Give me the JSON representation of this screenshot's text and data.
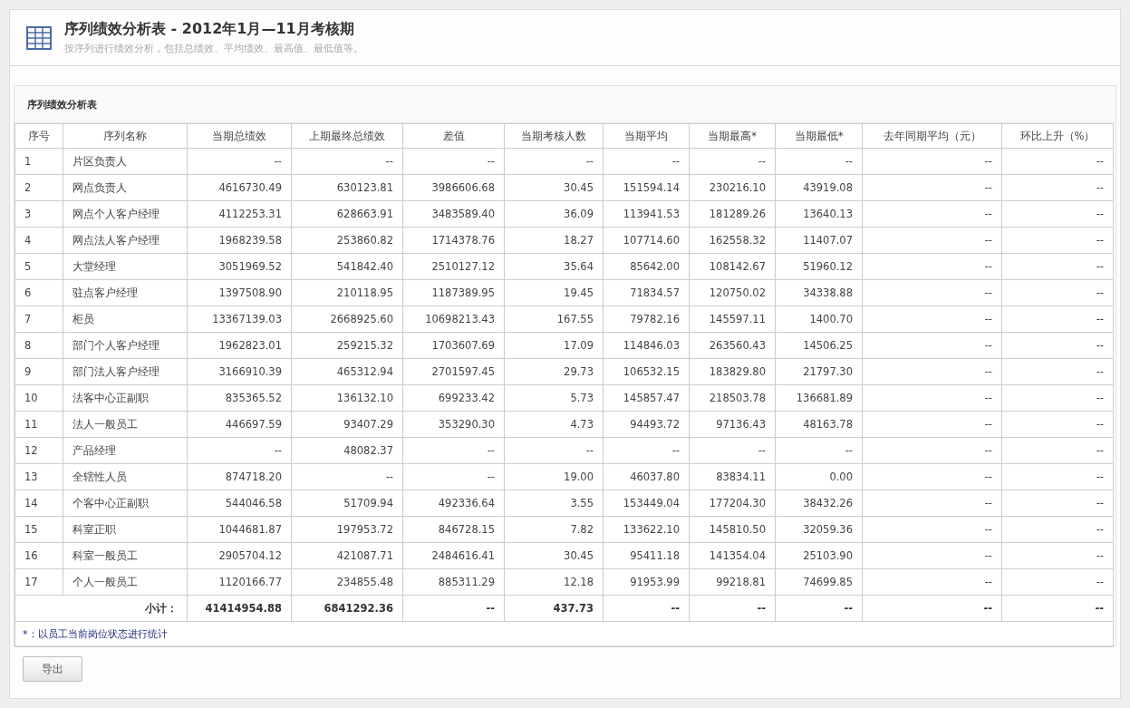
{
  "header": {
    "title": "序列绩效分析表 - 2012年1月—11月考核期",
    "subtitle": "按序列进行绩效分析，包括总绩效、平均绩效、最高值、最低值等。"
  },
  "panel": {
    "title": "序列绩效分析表"
  },
  "table": {
    "columns": [
      "序号",
      "序列名称",
      "当期总绩效",
      "上期最终总绩效",
      "差值",
      "当期考核人数",
      "当期平均",
      "当期最高*",
      "当期最低*",
      "去年同期平均（元）",
      "环比上升（%）"
    ],
    "rows": [
      [
        "1",
        "片区负责人",
        "--",
        "--",
        "--",
        "--",
        "--",
        "--",
        "--",
        "--",
        "--"
      ],
      [
        "2",
        "网点负责人",
        "4616730.49",
        "630123.81",
        "3986606.68",
        "30.45",
        "151594.14",
        "230216.10",
        "43919.08",
        "--",
        "--"
      ],
      [
        "3",
        "网点个人客户经理",
        "4112253.31",
        "628663.91",
        "3483589.40",
        "36.09",
        "113941.53",
        "181289.26",
        "13640.13",
        "--",
        "--"
      ],
      [
        "4",
        "网点法人客户经理",
        "1968239.58",
        "253860.82",
        "1714378.76",
        "18.27",
        "107714.60",
        "162558.32",
        "11407.07",
        "--",
        "--"
      ],
      [
        "5",
        "大堂经理",
        "3051969.52",
        "541842.40",
        "2510127.12",
        "35.64",
        "85642.00",
        "108142.67",
        "51960.12",
        "--",
        "--"
      ],
      [
        "6",
        "驻点客户经理",
        "1397508.90",
        "210118.95",
        "1187389.95",
        "19.45",
        "71834.57",
        "120750.02",
        "34338.88",
        "--",
        "--"
      ],
      [
        "7",
        "柜员",
        "13367139.03",
        "2668925.60",
        "10698213.43",
        "167.55",
        "79782.16",
        "145597.11",
        "1400.70",
        "--",
        "--"
      ],
      [
        "8",
        "部门个人客户经理",
        "1962823.01",
        "259215.32",
        "1703607.69",
        "17.09",
        "114846.03",
        "263560.43",
        "14506.25",
        "--",
        "--"
      ],
      [
        "9",
        "部门法人客户经理",
        "3166910.39",
        "465312.94",
        "2701597.45",
        "29.73",
        "106532.15",
        "183829.80",
        "21797.30",
        "--",
        "--"
      ],
      [
        "10",
        "法客中心正副职",
        "835365.52",
        "136132.10",
        "699233.42",
        "5.73",
        "145857.47",
        "218503.78",
        "136681.89",
        "--",
        "--"
      ],
      [
        "11",
        "法人一般员工",
        "446697.59",
        "93407.29",
        "353290.30",
        "4.73",
        "94493.72",
        "97136.43",
        "48163.78",
        "--",
        "--"
      ],
      [
        "12",
        "产品经理",
        "--",
        "48082.37",
        "--",
        "--",
        "--",
        "--",
        "--",
        "--",
        "--"
      ],
      [
        "13",
        "全辖性人员",
        "874718.20",
        "--",
        "--",
        "19.00",
        "46037.80",
        "83834.11",
        "0.00",
        "--",
        "--"
      ],
      [
        "14",
        "个客中心正副职",
        "544046.58",
        "51709.94",
        "492336.64",
        "3.55",
        "153449.04",
        "177204.30",
        "38432.26",
        "--",
        "--"
      ],
      [
        "15",
        "科室正职",
        "1044681.87",
        "197953.72",
        "846728.15",
        "7.82",
        "133622.10",
        "145810.50",
        "32059.36",
        "--",
        "--"
      ],
      [
        "16",
        "科室一般员工",
        "2905704.12",
        "421087.71",
        "2484616.41",
        "30.45",
        "95411.18",
        "141354.04",
        "25103.90",
        "--",
        "--"
      ],
      [
        "17",
        "个人一般员工",
        "1120166.77",
        "234855.48",
        "885311.29",
        "12.18",
        "91953.99",
        "99218.81",
        "74699.85",
        "--",
        "--"
      ]
    ],
    "subtotal": {
      "label": "小计：",
      "values": [
        "41414954.88",
        "6841292.36",
        "--",
        "437.73",
        "--",
        "--",
        "--",
        "--",
        "--"
      ]
    }
  },
  "footnote": "*：以员工当前岗位状态进行统计",
  "buttons": [
    "导出"
  ]
}
